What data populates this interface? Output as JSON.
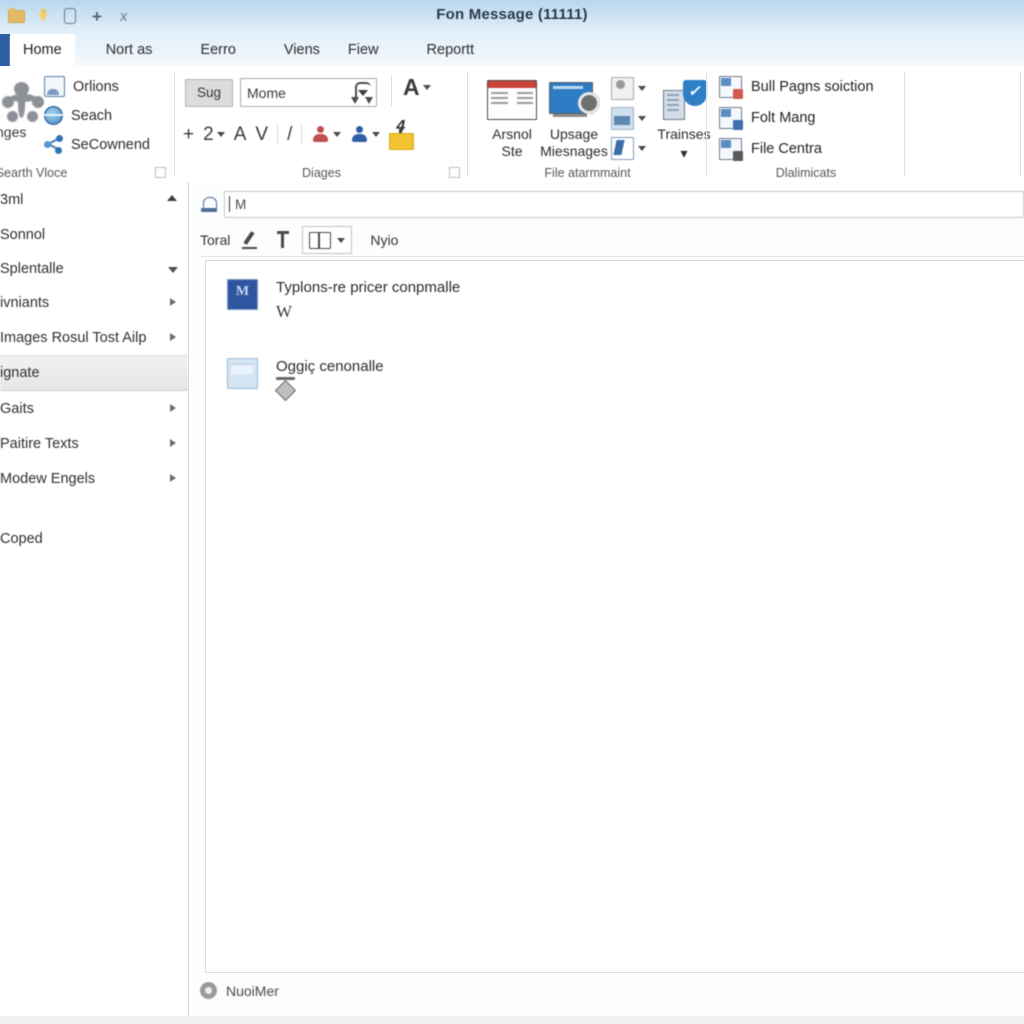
{
  "window": {
    "title": "Fon Message (11111)",
    "quick_access": [
      {
        "name": "folder-icon",
        "label": "Open"
      },
      {
        "name": "save-icon",
        "label": "Save"
      },
      {
        "name": "device-icon",
        "label": "Device"
      },
      {
        "name": "plus-icon",
        "label": "New"
      },
      {
        "name": "close-x-icon",
        "label": "Close"
      }
    ]
  },
  "tabs": [
    {
      "label": "Home",
      "active": true
    },
    {
      "label": "Nort as",
      "active": false
    },
    {
      "label": "Eerro",
      "active": false
    },
    {
      "label": "Viens",
      "active": false
    },
    {
      "label": "Fiew",
      "active": false
    },
    {
      "label": "Reportt",
      "active": false
    }
  ],
  "ribbon": {
    "groups": [
      {
        "label": "Searth Vloce",
        "big_button": {
          "label": "hges",
          "icon": "network-nodes-icon"
        },
        "items": [
          {
            "label": "Orlions",
            "icon": "image-icon"
          },
          {
            "label": "Seach",
            "icon": "globe-icon"
          },
          {
            "label": "SeCownend",
            "icon": "share-nodes-icon"
          }
        ],
        "has_dialog_launcher": true
      },
      {
        "label": "Diages",
        "button_sug": "Sug",
        "combo_value": "Mome",
        "row2": [
          {
            "label": "+",
            "name": "plus-tool"
          },
          {
            "label": "2",
            "name": "number-two-tool"
          },
          {
            "label": "A",
            "name": "letter-a-tool"
          },
          {
            "label": "V",
            "name": "letter-v-tool"
          },
          {
            "label": "/",
            "name": "slash-tool"
          }
        ],
        "font_glyph": "A",
        "has_dialog_launcher": true
      },
      {
        "label": "File atarmmaint",
        "big_buttons": [
          {
            "line1": "Arsnol",
            "line2": "Ste",
            "icon": "window-preview-icon"
          },
          {
            "line1": "Upsage",
            "line2": "Miesnages",
            "icon": "screen-settings-icon"
          },
          {
            "line1": "Trainses",
            "line2": "",
            "icon": "tower-shield-icon"
          }
        ],
        "small_buttons": [
          {
            "name": "person-search-icon"
          },
          {
            "name": "grid-photo-icon"
          },
          {
            "name": "pen-person-icon"
          }
        ]
      },
      {
        "label": "Dlalimicats",
        "items": [
          {
            "label": "Bull Pagns soiction",
            "icon": "page-selection-icon"
          },
          {
            "label": "Folt Mang",
            "icon": "folder-manage-icon"
          },
          {
            "label": "File Centra",
            "icon": "file-center-icon"
          }
        ]
      }
    ]
  },
  "sidebar": {
    "items": [
      {
        "label": "3ml",
        "arrow": "up"
      },
      {
        "label": "Sonnol",
        "arrow": "none"
      },
      {
        "label": "Splentalle",
        "arrow": "down"
      },
      {
        "label": "ivniants",
        "arrow": "right"
      },
      {
        "label": "Images Rosul Tost Ailp",
        "arrow": "right"
      },
      {
        "label": "ignate",
        "arrow": "none",
        "selected": true
      },
      {
        "label": "Gaits",
        "arrow": "right"
      },
      {
        "label": "Paitire Texts",
        "arrow": "right"
      },
      {
        "label": "Modew Engels",
        "arrow": "right"
      },
      {
        "label": "",
        "arrow": "none"
      },
      {
        "label": "Coped",
        "arrow": "none"
      }
    ]
  },
  "content": {
    "search": {
      "value": "M",
      "placeholder": ""
    },
    "toolbar": {
      "label": "Toral",
      "pen_icon": "pen-icon",
      "pin_icon": "pin-icon",
      "view_icon": "split-view-icon",
      "view_label": "Nyio"
    },
    "messages": [
      {
        "icon": "mail-thumbnail-icon",
        "subject": "Typlons-re pricer conpmalle",
        "secondary": "W",
        "secondary_icon": ""
      },
      {
        "icon": "folder-thumbnail-icon",
        "subject": "Oggiç cenonalle",
        "secondary": "",
        "secondary_icon": "diamond-stand-icon"
      }
    ],
    "status": {
      "icon": "info-circle-icon",
      "text": "NuoiMer"
    }
  },
  "colors": {
    "title_bar_top": "#b9d6ef",
    "tab_accent": "#2a5fa3",
    "selection": "#ececec",
    "mail_thumb": "#2e56a0",
    "red_accent": "#c9453c",
    "yellow_accent": "#f2c230"
  }
}
